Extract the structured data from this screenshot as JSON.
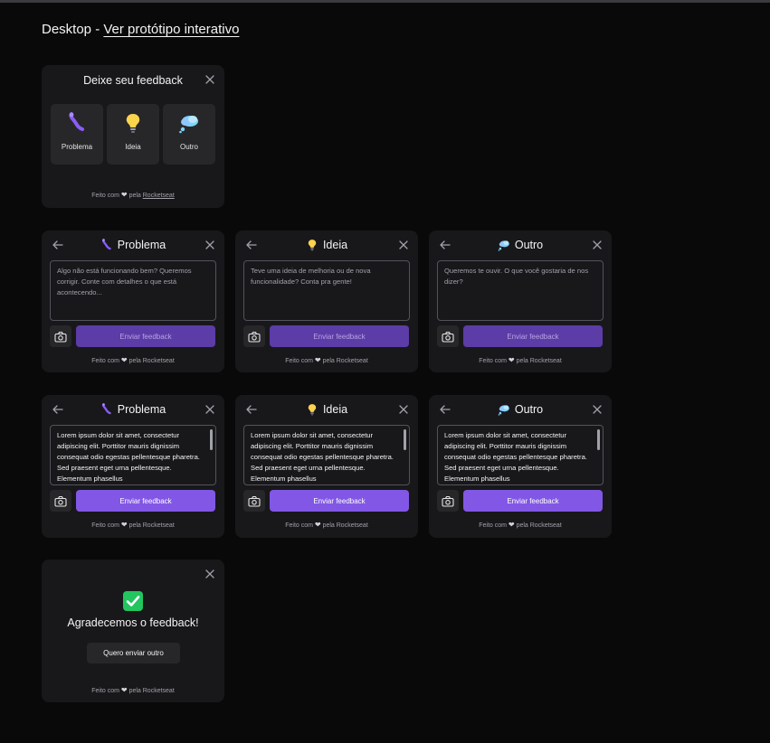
{
  "header": {
    "prefix": "Desktop - ",
    "link": "Ver protótipo interativo"
  },
  "widget": {
    "title": "Deixe seu feedback",
    "types": [
      {
        "label": "Problema",
        "icon": "worm-icon"
      },
      {
        "label": "Ideia",
        "icon": "lightbulb-icon"
      },
      {
        "label": "Outro",
        "icon": "thought-bubble-icon"
      }
    ],
    "footer": {
      "prefix": "Feito com",
      "middle": "pela",
      "brand": "Rocketseat"
    }
  },
  "forms": {
    "problema_title": "Problema",
    "ideia_title": "Ideia",
    "outro_title": "Outro",
    "problema_placeholder": "Algo não está funcionando bem? Queremos corrigir. Conte com detalhes o que está acontecendo...",
    "ideia_placeholder": "Teve uma ideia de melhoria ou de nova funcionalidade? Conta pra gente!",
    "outro_placeholder": "Queremos te ouvir. O que você gostaria de nos dizer?",
    "filled_text": "Lorem ipsum dolor sit amet, consectetur adipiscing elit. Porttitor mauris dignissim consequat odio egestas pellentesque pharetra. Sed praesent eget urna pellentesque. Elementum phasellus",
    "submit_label": "Enviar feedback"
  },
  "success": {
    "title": "Agradecemos o feedback!",
    "again_label": "Quero enviar outro"
  },
  "colors": {
    "background": "#09090a",
    "surface": "#18181b",
    "surface_secondary": "#27272a",
    "brand": "#8257e5",
    "brand_disabled": "#5c3ca6"
  }
}
